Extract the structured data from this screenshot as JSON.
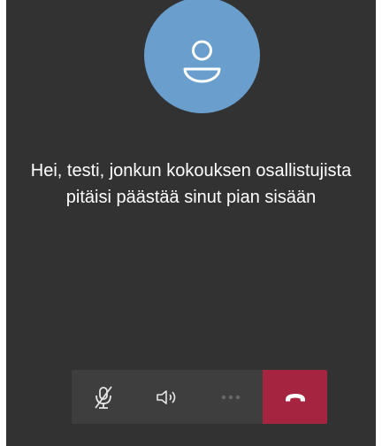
{
  "prejoin": {
    "avatar_icon": "person-icon",
    "message": "Hei, testi, jonkun kokouksen osallistujista pitäisi päästää sinut pian sisään"
  },
  "controls": {
    "items": [
      {
        "icon": "mic-off-icon"
      },
      {
        "icon": "speaker-icon"
      },
      {
        "icon": "more-icon"
      },
      {
        "icon": "hang-up-icon"
      }
    ]
  },
  "colors": {
    "background": "#323232",
    "avatar": "#6a9fcd",
    "control_bar": "#3e3e3e",
    "hang_up": "#a5243f"
  }
}
